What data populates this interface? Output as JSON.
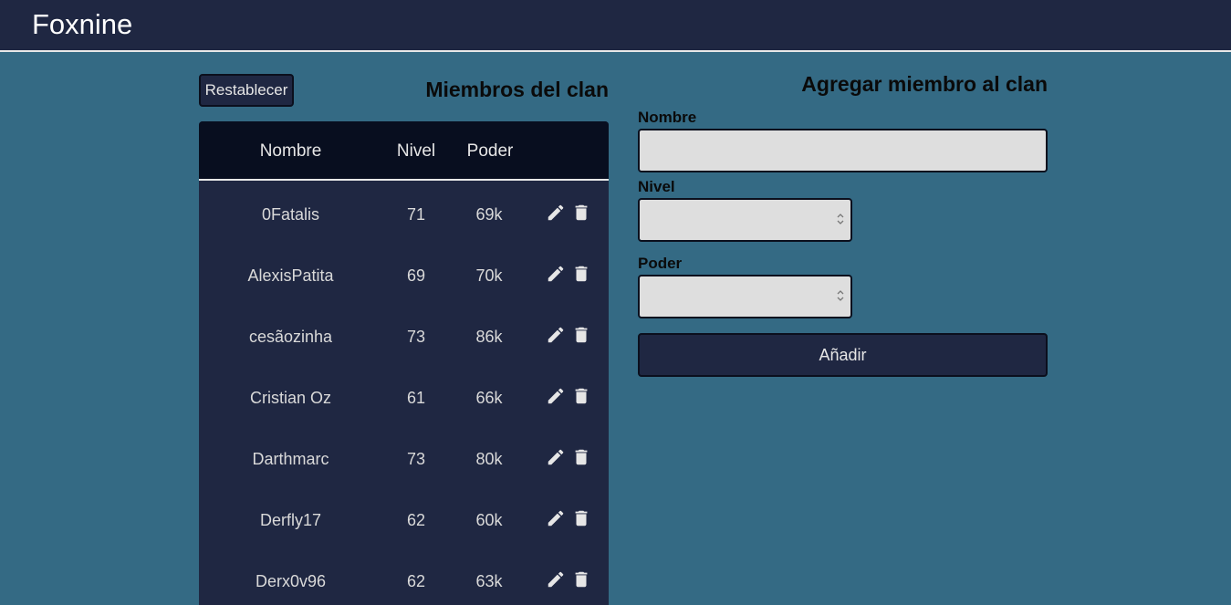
{
  "app": {
    "title": "Foxnine"
  },
  "members": {
    "reset_label": "Restablecer",
    "title": "Miembros del clan",
    "columns": {
      "name": "Nombre",
      "level": "Nivel",
      "power": "Poder"
    },
    "rows": [
      {
        "name": "0Fatalis",
        "level": "71",
        "power": "69k"
      },
      {
        "name": "AlexisPatita",
        "level": "69",
        "power": "70k"
      },
      {
        "name": "cesãozinha",
        "level": "73",
        "power": "86k"
      },
      {
        "name": "Cristian Oz",
        "level": "61",
        "power": "66k"
      },
      {
        "name": "Darthmarc",
        "level": "73",
        "power": "80k"
      },
      {
        "name": "Derfly17",
        "level": "62",
        "power": "60k"
      },
      {
        "name": "Derx0v96",
        "level": "62",
        "power": "63k"
      }
    ]
  },
  "form": {
    "title": "Agregar miembro al clan",
    "name_label": "Nombre",
    "name_value": "",
    "level_label": "Nivel",
    "level_value": "",
    "power_label": "Poder",
    "power_value": "",
    "submit_label": "Añadir"
  },
  "icons": {
    "edit": "pencil-icon",
    "delete": "trash-icon"
  },
  "colors": {
    "background": "#346a84",
    "navbar": "#1f2742",
    "table_header": "#080e1f",
    "table_body": "#1f2742",
    "input_background": "#dedede"
  }
}
